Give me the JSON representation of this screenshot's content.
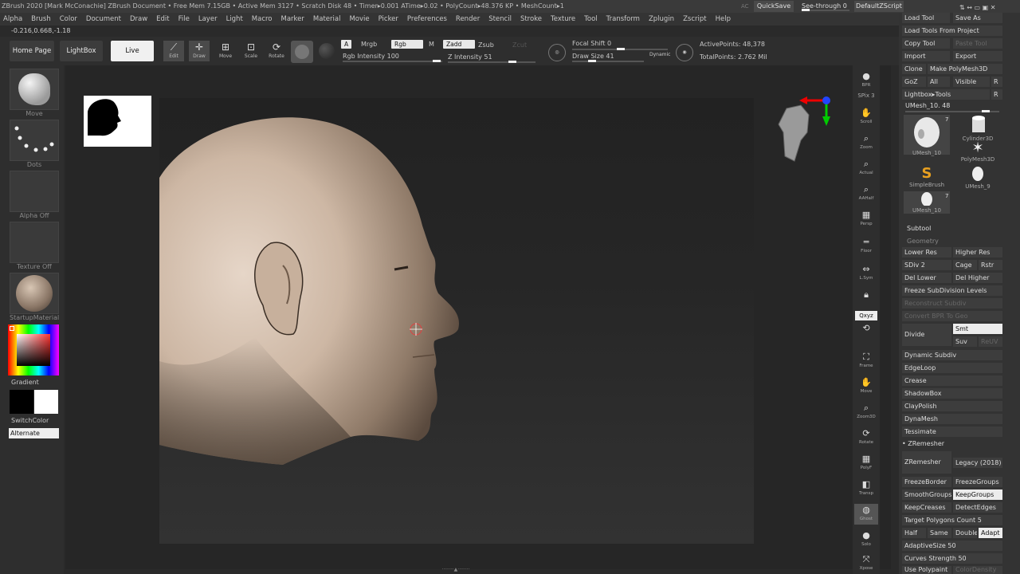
{
  "title_bar": {
    "text": "ZBrush 2020 [Mark McConachie]   ZBrush Document     • Free Mem 7.15GB • Active Mem 3127 • Scratch Disk 48 • Timer▸0.001 ATime▸0.02 • PolyCount▸48.376 KP • MeshCount▸1",
    "ac": "AC",
    "quicksave": "QuickSave",
    "see_through": "See-through  0",
    "default_zscript": "DefaultZScript"
  },
  "menu": [
    "Alpha",
    "Brush",
    "Color",
    "Document",
    "Draw",
    "Edit",
    "File",
    "Layer",
    "Light",
    "Macro",
    "Marker",
    "Material",
    "Movie",
    "Picker",
    "Preferences",
    "Render",
    "Stencil",
    "Stroke",
    "Texture",
    "Tool",
    "Transform",
    "Zplugin",
    "Zscript",
    "Help"
  ],
  "coords": "-0.216,0.668,-1.18",
  "toolbar": {
    "home": "Home Page",
    "lightbox": "LightBox",
    "live_boolean": "Live Boolean",
    "edit": "Edit",
    "draw": "Draw",
    "move": "Move",
    "scale": "Scale",
    "rotate": "Rotate",
    "a": "A",
    "mrgb": "Mrgb",
    "rgb": "Rgb",
    "m": "M",
    "zadd": "Zadd",
    "zsub": "Zsub",
    "zcut": "Zcut",
    "rgb_intensity": "Rgb Intensity 100",
    "z_intensity": "Z Intensity 51",
    "focal_shift": "Focal Shift 0",
    "draw_size": "Draw Size 41",
    "dynamic": "Dynamic",
    "active_points": "ActivePoints: 48,378",
    "total_points": "TotalPoints: 2.762 Mil"
  },
  "left_shelf": {
    "move": "Move",
    "dots": "Dots",
    "alpha_off": "Alpha Off",
    "texture_off": "Texture Off",
    "material": "StartupMaterial",
    "gradient": "Gradient",
    "switch_color": "SwitchColor",
    "alternate": "Alternate"
  },
  "right_shelf": {
    "bpr": "BPR",
    "spix": "SPix 3",
    "scroll": "Scroll",
    "zoom": "Zoom",
    "actual": "Actual",
    "aahalf": "AAHalf",
    "persp": "Persp",
    "floor": "Floor",
    "lsym": "L.Sym",
    "xyz": "Qxyz",
    "frame": "Frame",
    "move": "Move",
    "zoom3d": "Zoom3D",
    "rotate": "Rotate",
    "polyf": "PolyF",
    "transp": "Transp",
    "ghost": "Ghost",
    "solo": "Solo",
    "xpose": "Xpose"
  },
  "panel": {
    "load_tool": "Load Tool",
    "save_as": "Save As",
    "load_from_project": "Load Tools From Project",
    "copy_tool": "Copy Tool",
    "paste_tool": "Paste Tool",
    "import": "Import",
    "export": "Export",
    "clone": "Clone",
    "make_polymesh": "Make PolyMesh3D",
    "goz": "GoZ",
    "all": "All",
    "visible": "Visible",
    "r": "R",
    "lightbox_tools": "Lightbox▸Tools",
    "umesh_slider": "UMesh_10. 48",
    "meshes": [
      {
        "name": "UMesh_10",
        "count": "7"
      },
      {
        "name": "Cylinder3D",
        "count": ""
      },
      {
        "name": "PolyMesh3D",
        "count": ""
      },
      {
        "name": "SimpleBrush",
        "count": ""
      },
      {
        "name": "UMesh_9",
        "count": ""
      },
      {
        "name": "UMesh_10",
        "count": "7"
      }
    ],
    "subtool": "Subtool",
    "geometry": "Geometry",
    "lower_res": "Lower Res",
    "higher_res": "Higher Res",
    "sdiv": "SDiv 2",
    "cage": "Cage",
    "rstr": "Rstr",
    "del_lower": "Del Lower",
    "del_higher": "Del Higher",
    "freeze_subdiv": "Freeze SubDivision Levels",
    "reconstruct": "Reconstruct Subdiv",
    "convert_bpr": "Convert BPR To Geo",
    "divide": "Divide",
    "smt": "Smt",
    "suv": "Suv",
    "reuv": "ReUV",
    "dynamic_subdiv": "Dynamic Subdiv",
    "edgeloop": "EdgeLoop",
    "crease": "Crease",
    "shadowbox": "ShadowBox",
    "claypolish": "ClayPolish",
    "dynamesh": "DynaMesh",
    "tessimate": "Tessimate",
    "zremesher_header": "ZRemesher",
    "zremesher": "ZRemesher",
    "legacy": "Legacy (2018)",
    "freeze_border": "FreezeBorder",
    "freeze_groups": "FreezeGroups",
    "smooth_groups": "SmoothGroups",
    "keep_groups": "KeepGroups",
    "keep_creases": "KeepCreases",
    "detect_edges": "DetectEdges",
    "target_count": "Target Polygons Count 5",
    "half": "Half",
    "same": "Same",
    "double": "Double",
    "adapt": "Adapt",
    "adaptive_size": "AdaptiveSize 50",
    "curves_strength": "Curves Strength 50",
    "use_polypaint": "Use Polypaint",
    "color_density": "ColorDensity"
  }
}
